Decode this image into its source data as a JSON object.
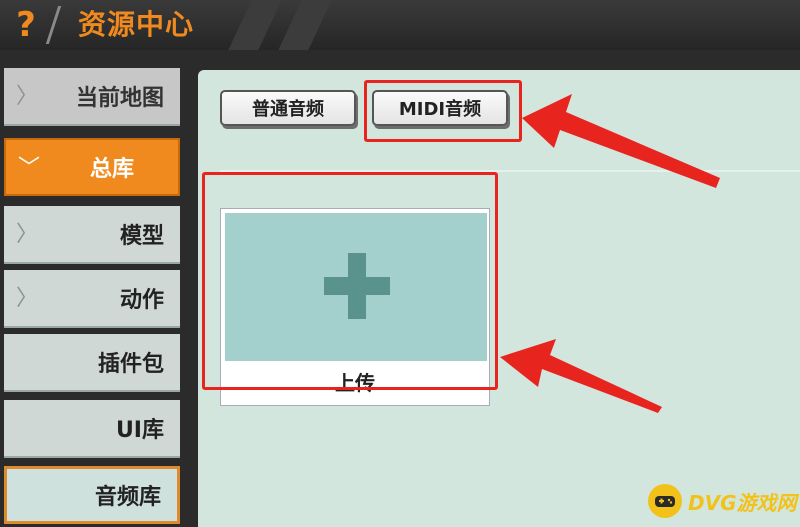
{
  "title": {
    "text": "资源中心",
    "icon": "question-icon"
  },
  "sidebar": {
    "items": [
      {
        "label": "当前地图",
        "state": "header"
      },
      {
        "label": "总库",
        "state": "active"
      },
      {
        "label": "模型",
        "state": "normal"
      },
      {
        "label": "动作",
        "state": "normal"
      },
      {
        "label": "插件包",
        "state": "normal"
      },
      {
        "label": "UI库",
        "state": "normal"
      },
      {
        "label": "音频库",
        "state": "selected"
      }
    ]
  },
  "tabs": [
    {
      "label": "普通音频"
    },
    {
      "label": "MIDI音频"
    }
  ],
  "upload": {
    "label": "上传"
  },
  "watermark": {
    "text": "DVG游戏网"
  },
  "colors": {
    "accent": "#f08a1e",
    "highlight": "#e8241f",
    "panel": "#d2e6dd",
    "upload_tile": "#a3d0cc"
  }
}
